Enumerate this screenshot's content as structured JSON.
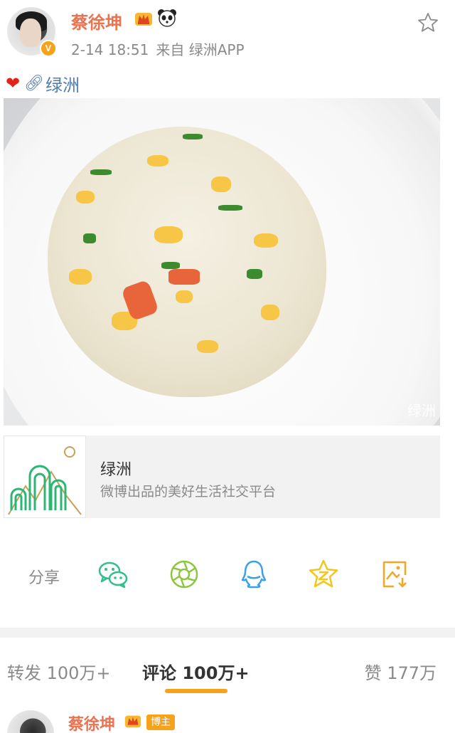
{
  "post": {
    "author": "蔡徐坤",
    "verified_badge": "V",
    "timestamp": "2-14 18:51",
    "source": "来自 绿洲APP",
    "text_link": "绿洲",
    "photo_watermark": "绿洲"
  },
  "link_card": {
    "title": "绿洲",
    "description": "微博出品的美好生活社交平台"
  },
  "share": {
    "label": "分享",
    "icons": [
      "wechat-icon",
      "moments-icon",
      "qq-icon",
      "qzone-icon",
      "save-image-icon"
    ]
  },
  "tabs": {
    "repost": "转发 100万+",
    "comments": "评论 100万+",
    "likes": "赞 177万"
  },
  "first_comment": {
    "author": "蔡徐坤",
    "badge": "博主"
  },
  "colors": {
    "username": "#eb7350",
    "link": "#507daf",
    "accent": "#f7a21b",
    "wechat": "#2fbf8a",
    "qq": "#3aa0e8",
    "qzone": "#f5c518",
    "save": "#f5a623"
  }
}
